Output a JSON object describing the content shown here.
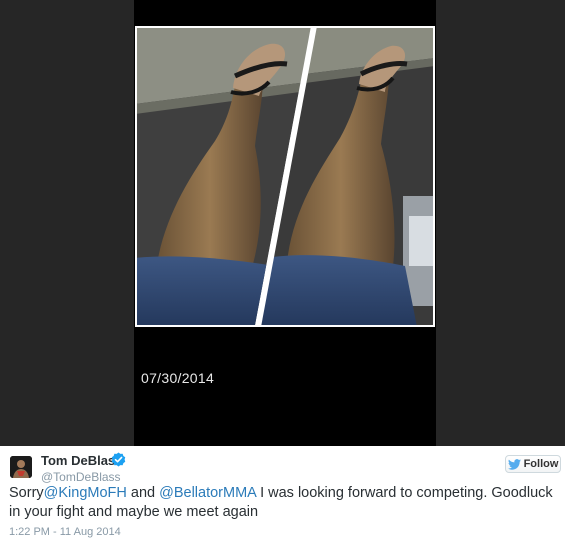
{
  "photo": {
    "date_stamp": "07/30/2014"
  },
  "author": {
    "name": "Tom DeBlass",
    "handle": "@TomDeBlass",
    "verified": true
  },
  "follow_button": {
    "label": "Follow"
  },
  "tweet": {
    "part1": "Sorry",
    "mention1": "@KingMoFH",
    "part2": " and ",
    "mention2": "@BellatorMMA",
    "part3": " I was looking forward to competing. Goodluck in your fight and maybe we meet again"
  },
  "timestamp": "1:22 PM - 11 Aug 2014",
  "colors": {
    "link": "#2b7bb9",
    "verified": "#1da1f2",
    "twitter_bird": "#55acee"
  }
}
